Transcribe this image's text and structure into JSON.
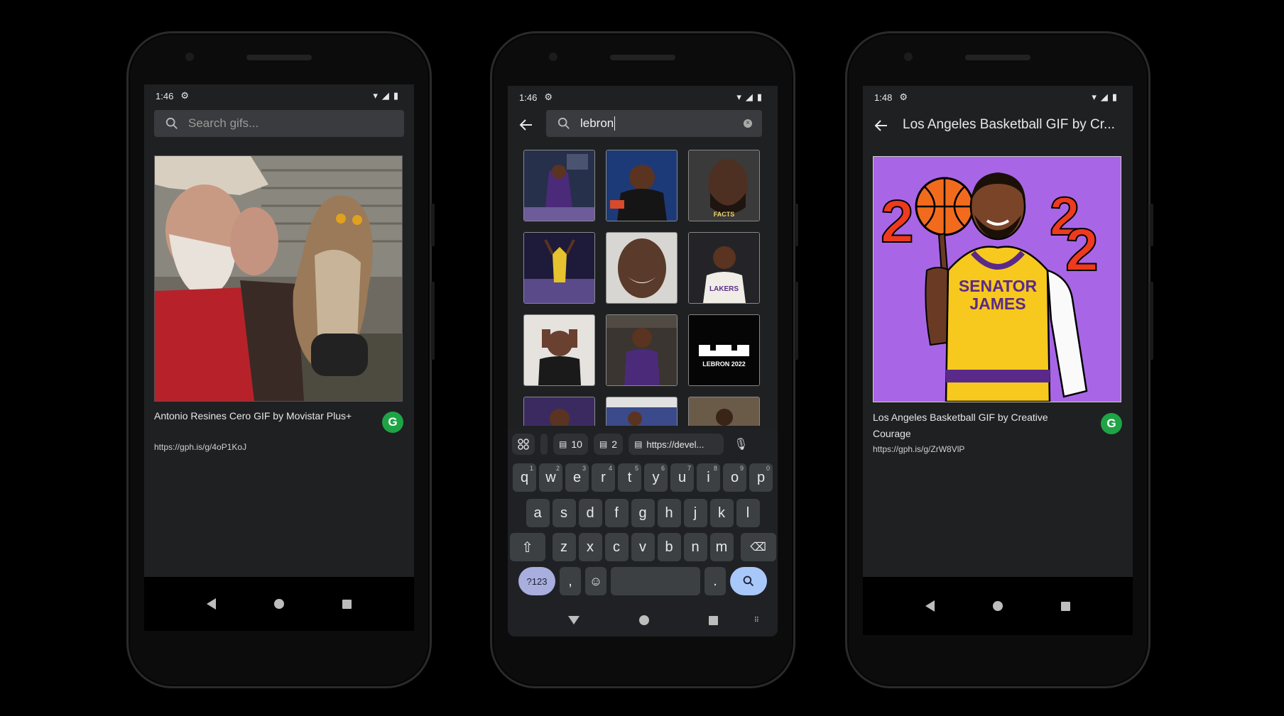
{
  "phone1": {
    "status_time": "1:46",
    "search_placeholder": "Search gifs...",
    "gif_title": "Antonio Resines Cero GIF by Movistar Plus+",
    "gif_link": "https://gph.is/g/4oP1KoJ",
    "badge_letter": "G"
  },
  "phone2": {
    "status_time": "1:46",
    "search_query": "lebron",
    "thumb_labels": {
      "facts": "FACTS",
      "lebron_logo": "LEBRON 2022",
      "lakers": "LAKERS"
    },
    "suggestions": {
      "chip1_count": "10",
      "chip2_count": "2",
      "chip3_text": "https://devel..."
    },
    "keyboard": {
      "row1": [
        {
          "k": "q",
          "n": "1"
        },
        {
          "k": "w",
          "n": "2"
        },
        {
          "k": "e",
          "n": "3"
        },
        {
          "k": "r",
          "n": "4"
        },
        {
          "k": "t",
          "n": "5"
        },
        {
          "k": "y",
          "n": "6"
        },
        {
          "k": "u",
          "n": "7"
        },
        {
          "k": "i",
          "n": "8"
        },
        {
          "k": "o",
          "n": "9"
        },
        {
          "k": "p",
          "n": "0"
        }
      ],
      "row2": [
        "a",
        "s",
        "d",
        "f",
        "g",
        "h",
        "j",
        "k",
        "l"
      ],
      "row3": [
        "z",
        "x",
        "c",
        "v",
        "b",
        "n",
        "m"
      ],
      "symbols_label": "?123",
      "comma": ",",
      "period": "."
    }
  },
  "phone3": {
    "status_time": "1:48",
    "appbar_title": "Los Angeles Basketball GIF by Cr...",
    "gif_title": "Los Angeles Basketball GIF by Creative Courage",
    "gif_link": "https://gph.is/g/ZrW8VlP",
    "badge_letter": "G",
    "art_text_line1": "SENATOR",
    "art_text_line2": "JAMES",
    "art_numbers": [
      "2",
      "2",
      "2"
    ]
  },
  "colors": {
    "accent_green": "#1ea446",
    "art_purple": "#a866e6",
    "screen_bg": "#1f2022"
  }
}
